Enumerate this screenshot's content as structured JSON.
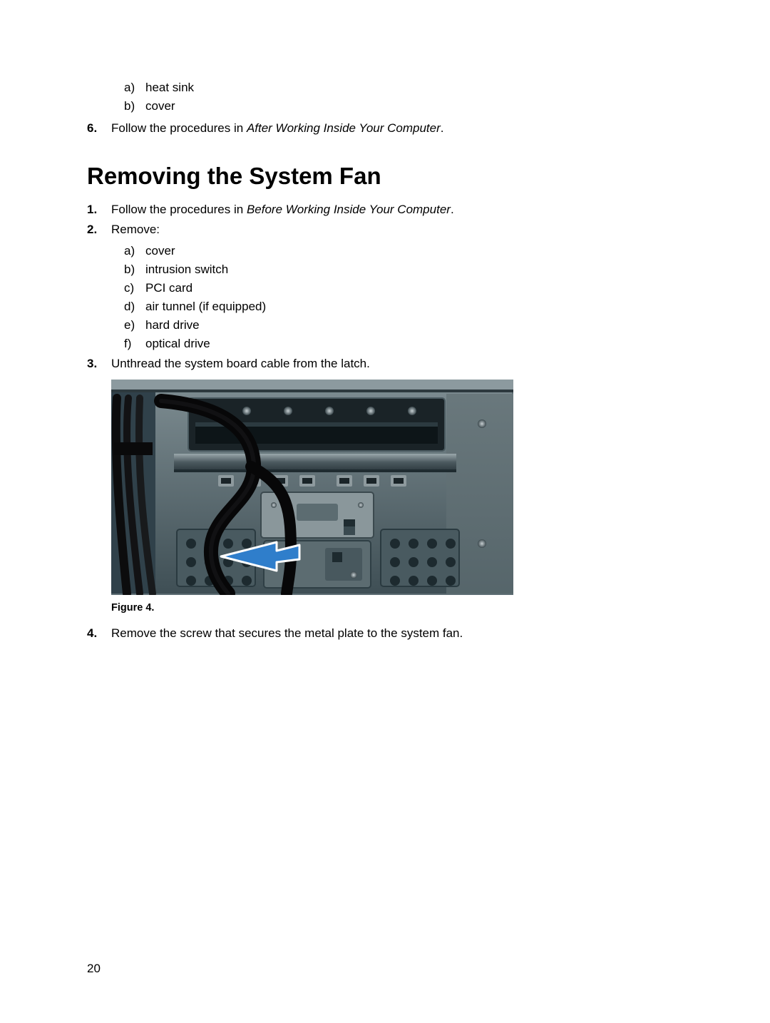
{
  "prev_list": {
    "a_marker": "a)",
    "a_text": "heat sink",
    "b_marker": "b)",
    "b_text": "cover"
  },
  "step6": {
    "marker": "6.",
    "lead": "Follow the procedures in ",
    "em": "After Working Inside Your Computer",
    "tail": "."
  },
  "heading": "Removing the System Fan",
  "steps": {
    "s1": {
      "marker": "1.",
      "lead": "Follow the procedures in ",
      "em": "Before Working Inside Your Computer",
      "tail": "."
    },
    "s2": {
      "marker": "2.",
      "text": "Remove:",
      "items": {
        "a_marker": "a)",
        "a_text": "cover",
        "b_marker": "b)",
        "b_text": "intrusion switch",
        "c_marker": "c)",
        "c_text": "PCI card",
        "d_marker": "d)",
        "d_text": "air tunnel (if equipped)",
        "e_marker": "e)",
        "e_text": "hard drive",
        "f_marker": "f)",
        "f_text": "optical drive"
      }
    },
    "s3": {
      "marker": "3.",
      "text": "Unthread the system board cable from the latch."
    },
    "s4": {
      "marker": "4.",
      "text": "Remove the screw that secures the metal plate to the system fan."
    }
  },
  "figure_caption": "Figure 4.",
  "page_number": "20"
}
